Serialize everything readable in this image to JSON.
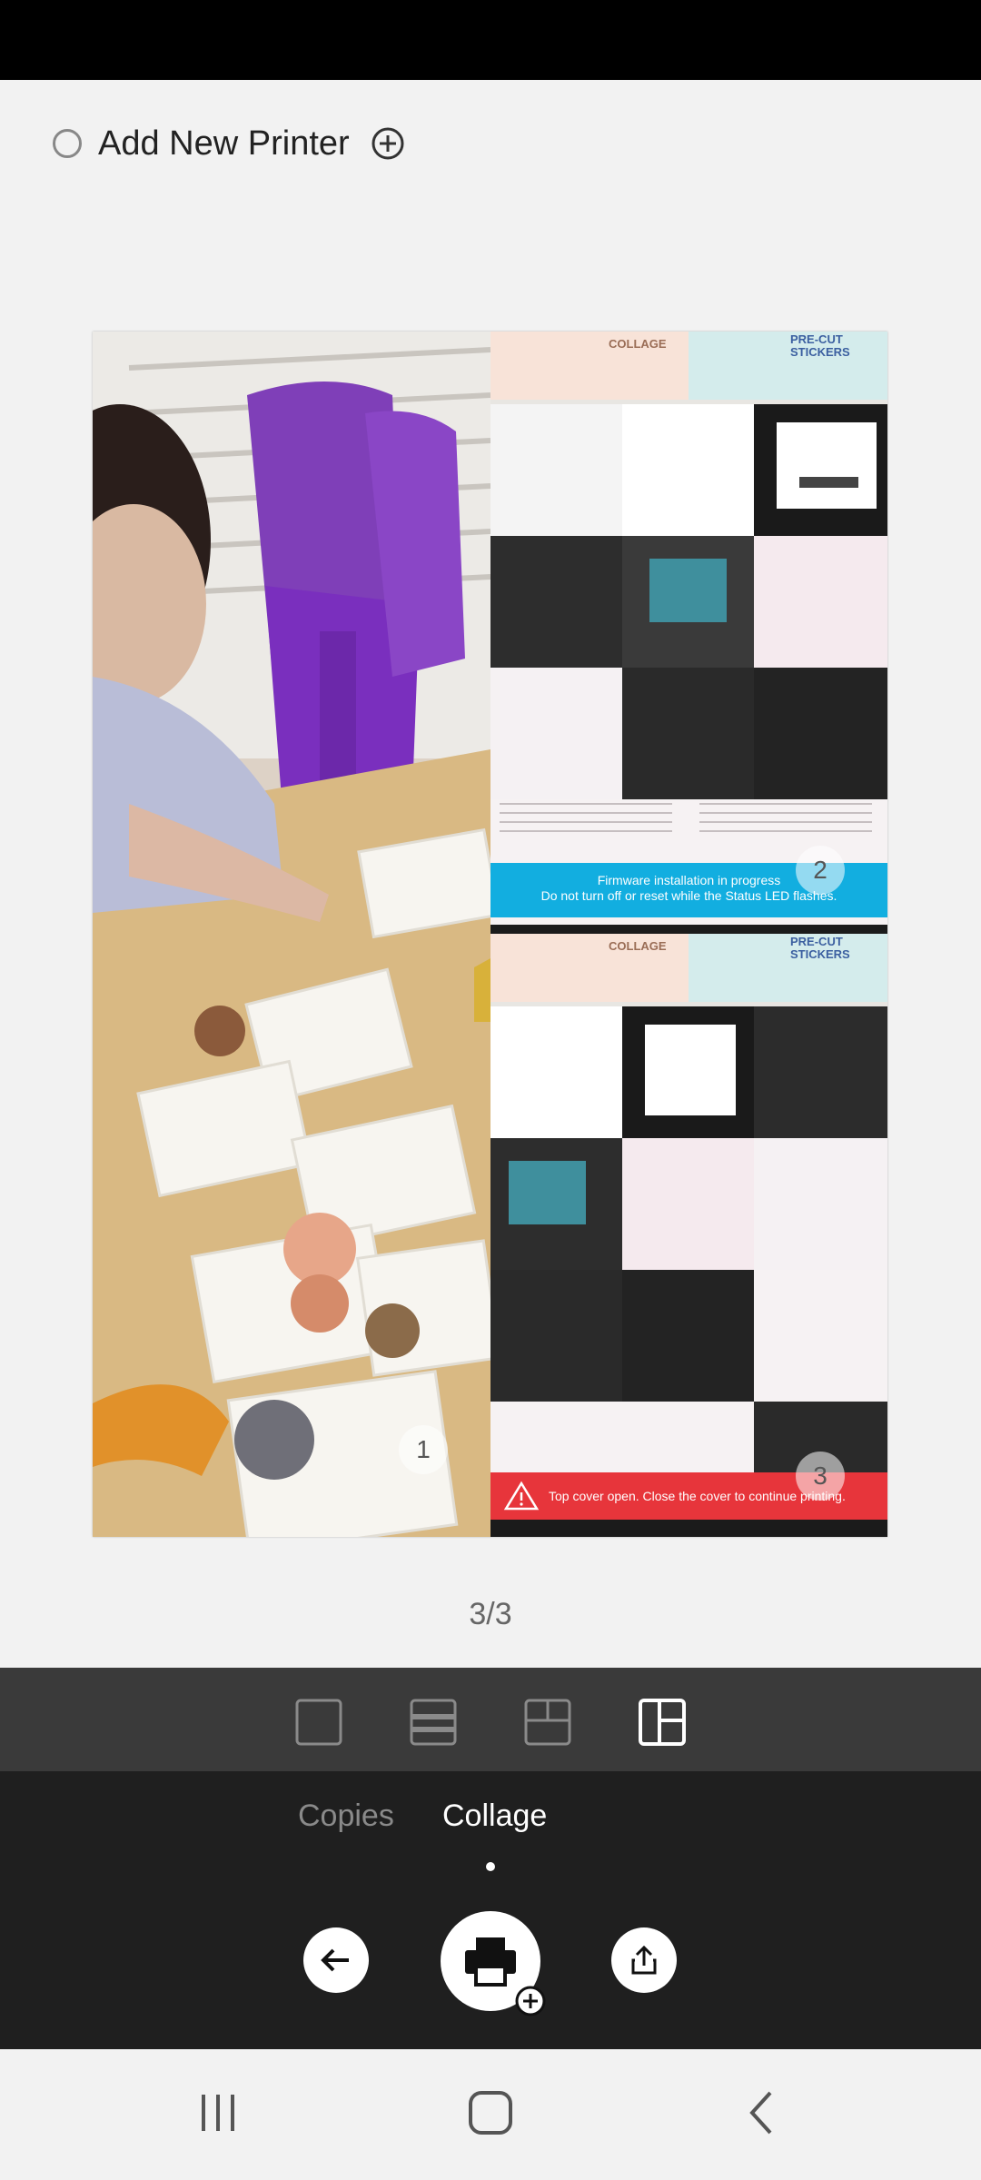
{
  "printer": {
    "label": "Add New Printer"
  },
  "collage": {
    "badges": [
      "1",
      "2",
      "3"
    ],
    "thumb_text": {
      "collage_label": "COLLAGE",
      "stickers_label": "PRE-CUT STICKERS",
      "firmware_banner_line1": "Firmware installation in progress",
      "firmware_banner_line2": "Do not turn off or reset while the Status LED flashes.",
      "cover_banner": "Top cover open. Close the cover to continue printing."
    }
  },
  "pager": {
    "text": "3/3"
  },
  "layout_options": [
    "single-layout-icon",
    "two-row-layout-icon",
    "three-grid-layout-icon",
    "four-grid-layout-icon"
  ],
  "tabs": {
    "copies": "Copies",
    "collage": "Collage",
    "active": "Collage"
  },
  "colors": {
    "accent_blue": "#12aee0",
    "error_red": "#e7353b",
    "panel_dark": "#1f1f1f",
    "layout_bar": "#3a3a3a"
  }
}
